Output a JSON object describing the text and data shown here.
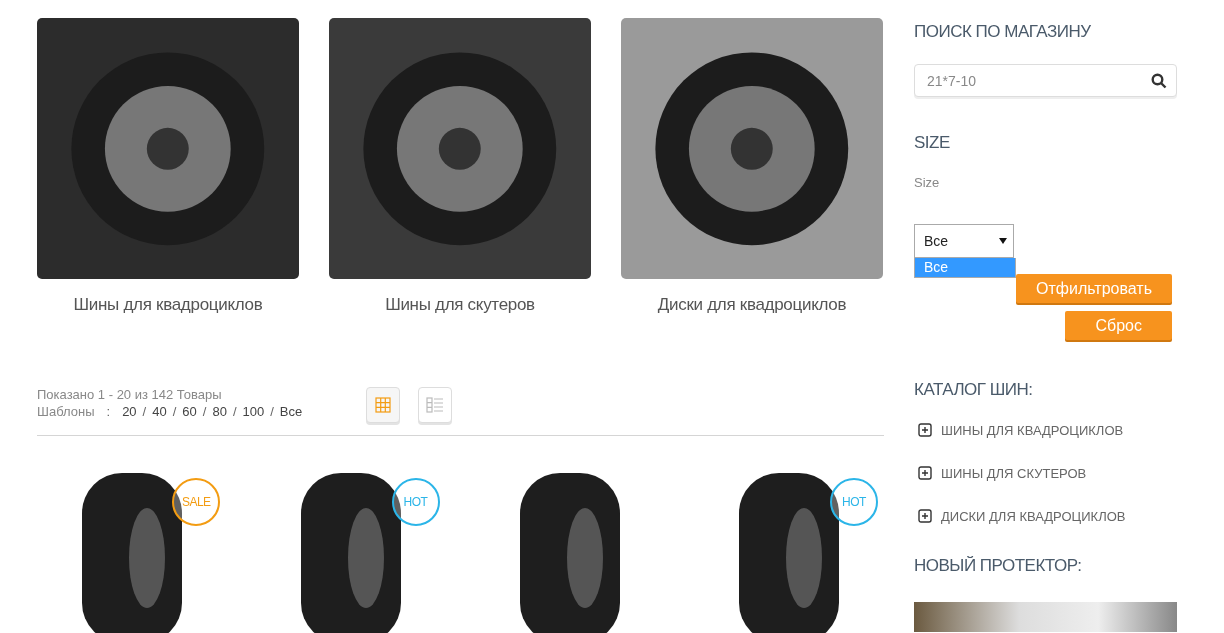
{
  "categories": [
    {
      "name": "Шины для квадроциклов"
    },
    {
      "name": "Шины для скутеров"
    },
    {
      "name": "Диски для квадроциклов"
    }
  ],
  "listing": {
    "summary": "Показано 1 - 20 из 142 Товары",
    "per_page_label": "Шаблоны",
    "per_page_separator": ":",
    "per_page_divider": "/",
    "per_page_options": [
      "20",
      "40",
      "60",
      "80",
      "100",
      "Все"
    ],
    "view_toggle": [
      {
        "kind": "grid",
        "selected": true
      },
      {
        "kind": "list",
        "selected": false
      }
    ]
  },
  "products": [
    {
      "kind": "tire",
      "badge": {
        "kind": "sale",
        "label": "SALE"
      }
    },
    {
      "kind": "tire",
      "badge": {
        "kind": "hot",
        "label": "HOT"
      }
    },
    {
      "kind": "tire"
    },
    {
      "kind": "tire",
      "badge": {
        "kind": "hot",
        "label": "HOT"
      }
    }
  ],
  "sidebar": {
    "search": {
      "title": "ПОИСК ПО МАГАЗИНУ",
      "placeholder": "21*7-10"
    },
    "size_filter": {
      "title": "SIZE",
      "label": "Size",
      "value": "Все",
      "options": [
        {
          "label": "Все",
          "selected": true
        }
      ],
      "buttons": [
        "Отфильтровать",
        "Сброс"
      ]
    },
    "catalog": {
      "title": "КАТАЛОГ ШИН:",
      "items": [
        {
          "label": "ШИНЫ ДЛЯ КВАДРОЦИКЛОВ",
          "expanded": false
        },
        {
          "label": "ШИНЫ ДЛЯ СКУТЕРОВ",
          "expanded": false
        },
        {
          "label": "ДИСКИ ДЛЯ КВАДРОЦИКЛОВ",
          "expanded": false
        }
      ]
    },
    "promo": {
      "title": "НОВЫЙ ПРОТЕКТОР:"
    }
  }
}
